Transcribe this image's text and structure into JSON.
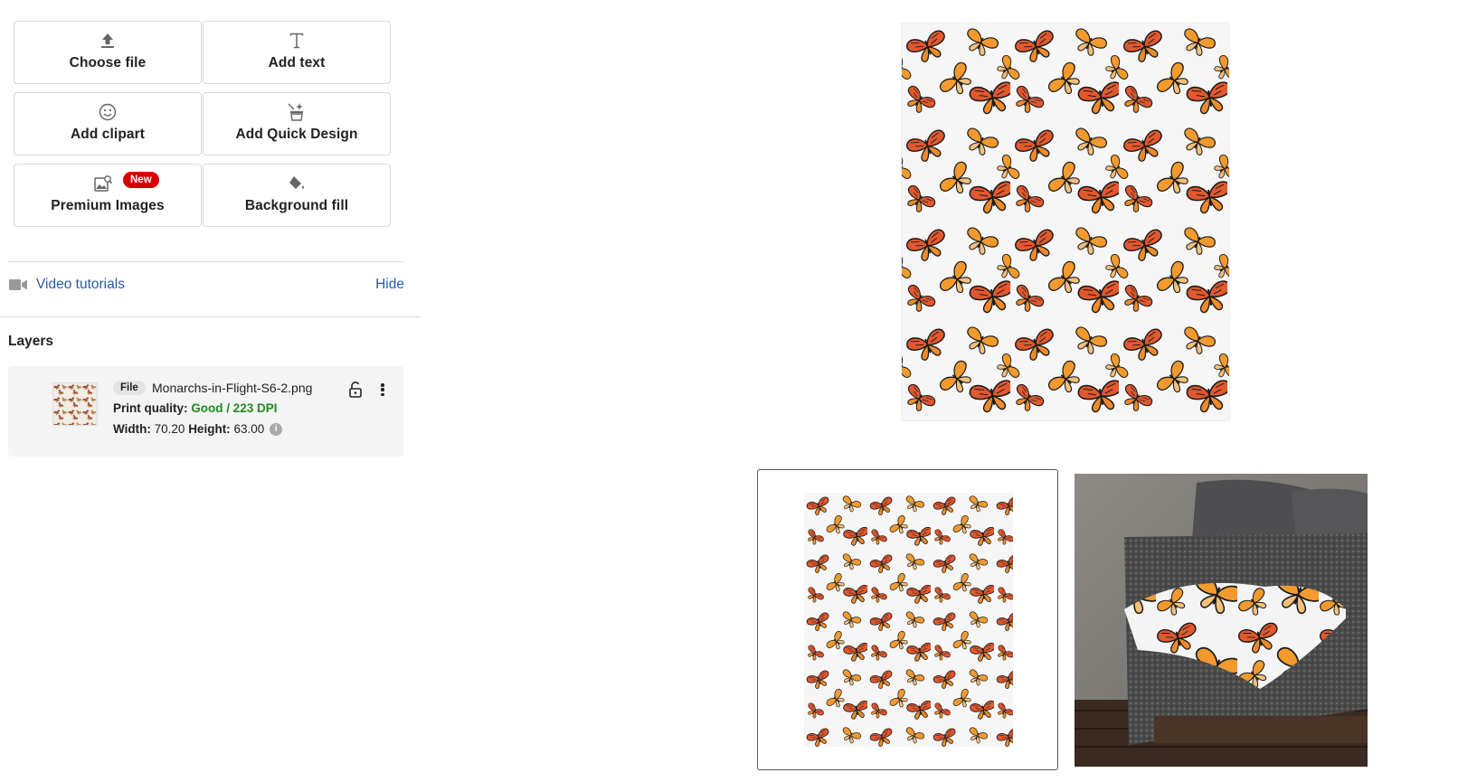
{
  "tools": {
    "choose_file": "Choose file",
    "add_text": "Add text",
    "add_clipart": "Add clipart",
    "add_quick_design": "Add Quick Design",
    "premium_images": "Premium Images",
    "premium_badge": "New",
    "background_fill": "Background fill"
  },
  "tutorials": {
    "link": "Video tutorials",
    "hide": "Hide"
  },
  "layers": {
    "title": "Layers",
    "items": [
      {
        "type_chip": "File",
        "file_name": "Monarchs-in-Flight-S6-2.png",
        "print_quality_label": "Print quality:",
        "print_quality_value": "Good / 223 DPI",
        "width_label": "Width:",
        "width_value": "70.20",
        "height_label": "Height:",
        "height_value": "63.00"
      }
    ]
  },
  "colors": {
    "accent_link": "#2a5aa8",
    "badge_red": "#d40000",
    "quality_good": "#1f8a1f",
    "butterfly_orange": "#e07a20",
    "butterfly_red": "#d8553a"
  }
}
